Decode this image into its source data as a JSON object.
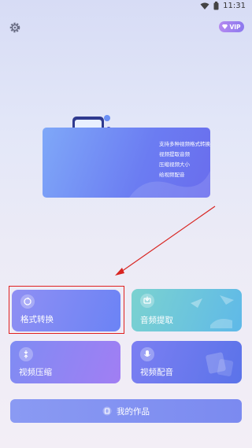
{
  "status_bar": {
    "time": "11:31"
  },
  "header": {
    "vip_label": "VIP"
  },
  "banner": {
    "lines": [
      "支持多种视频格式转换",
      "视频提取音频",
      "压缩视频大小",
      "给视频配音"
    ]
  },
  "features": {
    "format_convert": "格式转换",
    "audio_extract": "音频提取",
    "video_compress": "视频压缩",
    "video_dub": "视频配音"
  },
  "my_works": {
    "label": "我的作品"
  },
  "colors": {
    "accent": "#6b83f5",
    "highlight": "#e0201f",
    "vip": "#9a7ef0"
  }
}
